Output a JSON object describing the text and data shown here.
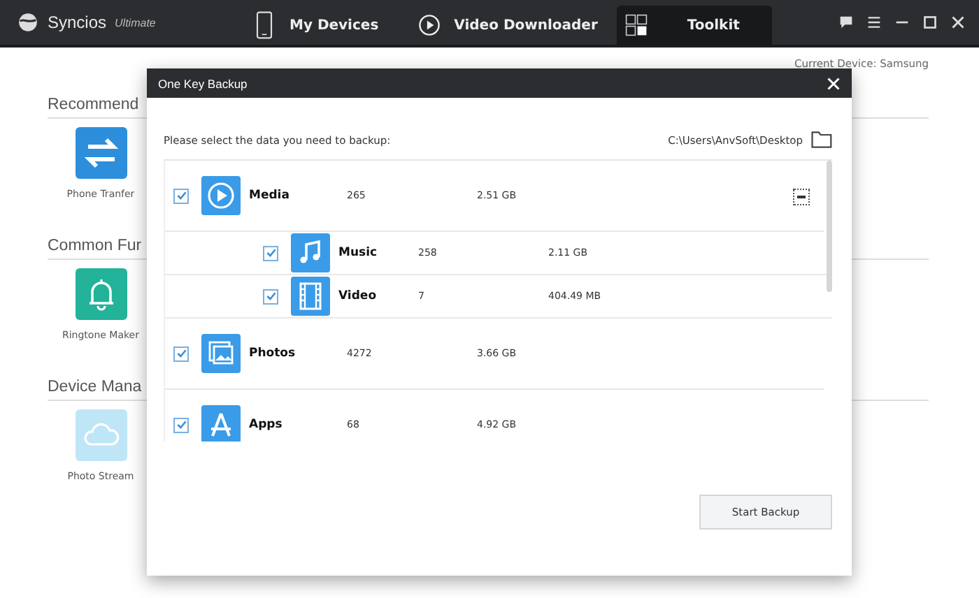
{
  "app": {
    "name": "Syncios",
    "edition": "Ultimate"
  },
  "tabs": [
    {
      "label": "My Devices",
      "kind": "phone",
      "selected": false
    },
    {
      "label": "Video Downloader",
      "kind": "play",
      "selected": false
    },
    {
      "label": "Toolkit",
      "kind": "grid",
      "selected": true
    }
  ],
  "device_label": "Current Device: Samsung",
  "sections": [
    {
      "heading": "Recommend",
      "tools": [
        {
          "label": "Phone Tranfer",
          "kind": "transfer",
          "disabled": false
        }
      ]
    },
    {
      "heading": "Common Fur",
      "tools": [
        {
          "label": "Ringtone Maker",
          "kind": "bell",
          "disabled": false
        }
      ]
    },
    {
      "heading": "Device Mana",
      "tools": [
        {
          "label": "Photo Stream",
          "kind": "cloud",
          "disabled": true
        }
      ]
    }
  ],
  "dialog": {
    "title": "One Key Backup",
    "prompt": "Please select the data you need to backup:",
    "path": "C:\\Users\\AnvSoft\\Desktop",
    "items": [
      {
        "name": "Media",
        "kind": "media",
        "count": "265",
        "size": "2.51 GB",
        "checked": true,
        "expanded": true,
        "children": [
          {
            "name": "Music",
            "kind": "music",
            "count": "258",
            "size": "2.11 GB",
            "checked": true
          },
          {
            "name": "Video",
            "kind": "video",
            "count": "7",
            "size": "404.49 MB",
            "checked": true
          }
        ]
      },
      {
        "name": "Photos",
        "kind": "photos",
        "count": "4272",
        "size": "3.66 GB",
        "checked": true
      },
      {
        "name": "Apps",
        "kind": "apps",
        "count": "68",
        "size": "4.92 GB",
        "checked": true
      }
    ],
    "button": "Start Backup"
  }
}
